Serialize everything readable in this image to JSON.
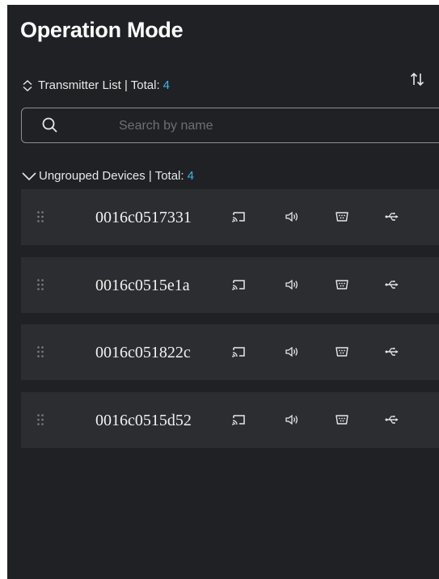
{
  "title": "Operation Mode",
  "transmitter_list": {
    "label": "Transmitter List | Total:",
    "total": "4"
  },
  "search": {
    "placeholder": "Search by name",
    "value": ""
  },
  "group": {
    "label": "Ungrouped Devices | Total:",
    "total": "4"
  },
  "devices": [
    {
      "name": "0016c0517331"
    },
    {
      "name": "0016c0515e1a"
    },
    {
      "name": "0016c051822c"
    },
    {
      "name": "0016c0515d52"
    }
  ],
  "icons": {
    "sort": "sort-arrows-icon",
    "expand": "expand-collapse-icon",
    "search": "search-icon",
    "group_toggle": "chevron-down-icon",
    "drag": "drag-handle-icon",
    "cast": "cast-icon",
    "audio": "speaker-icon",
    "serial": "serial-port-icon",
    "usb": "usb-icon"
  },
  "colors": {
    "background": "#202124",
    "row_background": "#2b2d31",
    "accent": "#3fb6e6",
    "text": "#e8e8e8"
  }
}
